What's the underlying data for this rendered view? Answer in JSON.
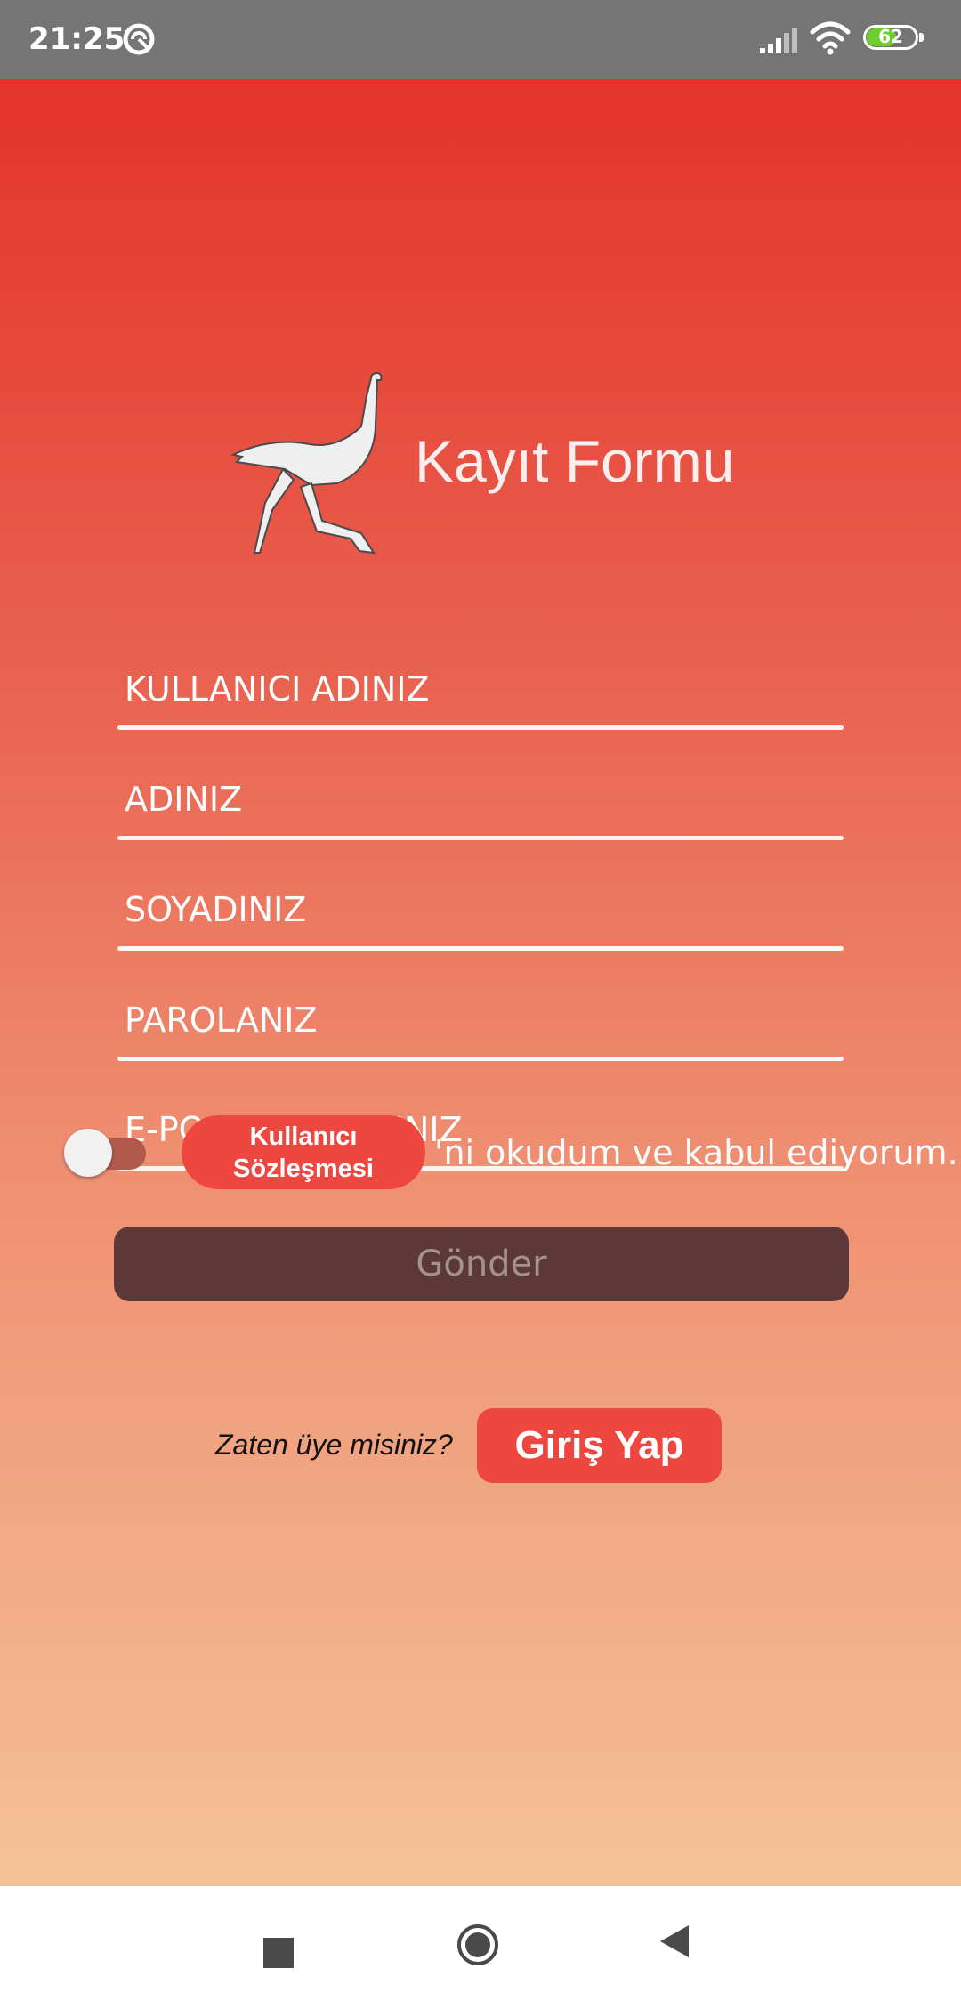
{
  "status_bar": {
    "time": "21:25",
    "battery_level": 62,
    "battery_text": "62",
    "icons": [
      "no-disturb-icon",
      "signal-icon",
      "wifi-icon",
      "battery-icon"
    ]
  },
  "header": {
    "title": "Kayıt Formu",
    "logo_icon": "ostrich-logo-icon"
  },
  "form": {
    "fields": [
      {
        "name": "username",
        "placeholder": "KULLANICI ADINIZ",
        "value": ""
      },
      {
        "name": "first_name",
        "placeholder": "ADINIZ",
        "value": ""
      },
      {
        "name": "last_name",
        "placeholder": "SOYADINIZ",
        "value": ""
      },
      {
        "name": "password",
        "placeholder": "PAROLANIZ",
        "value": ""
      },
      {
        "name": "email",
        "placeholder": "E-POSTA ADRESINIZ",
        "value": ""
      }
    ],
    "agreement": {
      "toggle_on": false,
      "button_line1": "Kullanıcı",
      "button_line2": "Sözleşmesi",
      "suffix": "'ni okudum ve kabul ediyorum."
    },
    "submit_label": "Gönder"
  },
  "login": {
    "prompt": "Zaten üye misiniz?",
    "button_label": "Giriş Yap"
  },
  "colors": {
    "gradient_top": "#e4332b",
    "gradient_bottom": "#f4c297",
    "accent_button": "#ee4740",
    "submit_bg": "#5c3838",
    "submit_text": "#a49191",
    "toggle_track": "#b15a4c"
  },
  "nav_bar": {
    "buttons": [
      "recents-icon",
      "home-icon",
      "back-icon"
    ]
  }
}
